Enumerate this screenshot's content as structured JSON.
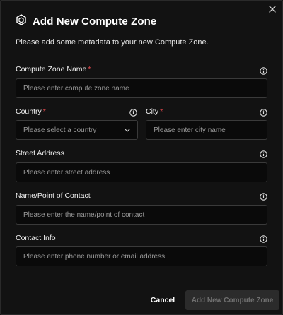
{
  "dialog": {
    "title": "Add New Compute Zone",
    "subtitle": "Please add some metadata to your new Compute Zone.",
    "icons": {
      "header": "hexagon-nodes-icon",
      "close": "close-icon",
      "info": "info-icon",
      "dropdown": "chevron-down-icon"
    },
    "fields": {
      "zone_name": {
        "label": "Compute Zone Name",
        "required_mark": "*",
        "placeholder": "Please enter compute zone name"
      },
      "country": {
        "label": "Country",
        "required_mark": "*",
        "placeholder": "Please select a country"
      },
      "city": {
        "label": "City",
        "required_mark": "*",
        "placeholder": "Please enter city name"
      },
      "street": {
        "label": "Street Address",
        "placeholder": "Please enter street address"
      },
      "contact": {
        "label": "Name/Point of Contact",
        "placeholder": "Please enter the name/point of contact"
      },
      "contact_info": {
        "label": "Contact Info",
        "placeholder": "Please enter phone number or email address"
      }
    },
    "footer": {
      "cancel_label": "Cancel",
      "submit_label": "Add New Compute Zone"
    },
    "colors": {
      "background": "#121212",
      "required": "#e5484d",
      "input_border": "#3a3a3a",
      "disabled_button": "#2b2b2b"
    }
  }
}
